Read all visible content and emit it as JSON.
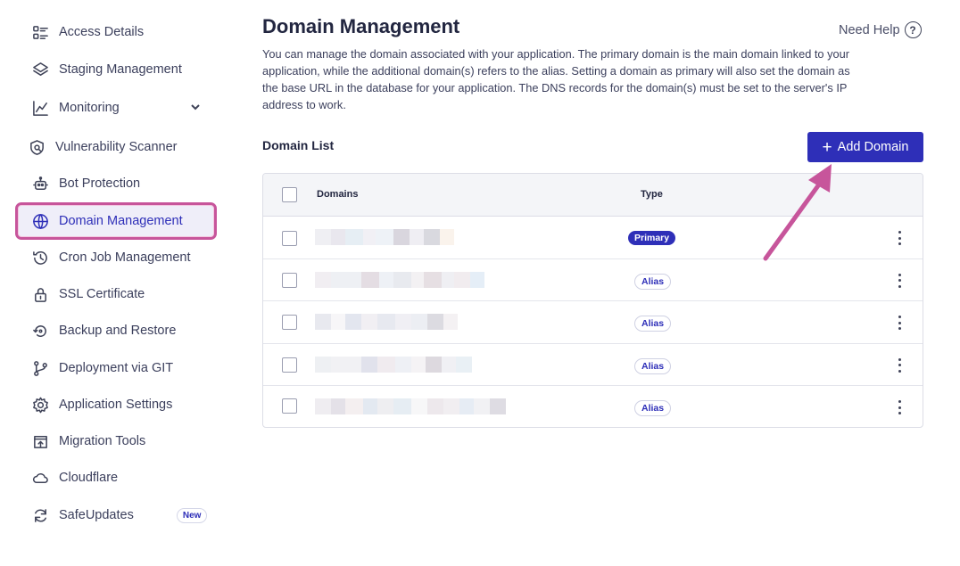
{
  "sidebar": {
    "items": [
      {
        "label": "Access Details",
        "icon": "access-details-icon"
      },
      {
        "label": "Staging Management",
        "icon": "layers-icon"
      },
      {
        "label": "Monitoring",
        "icon": "chart-line-icon"
      },
      {
        "label": "Vulnerability Scanner",
        "icon": "shield-scan-icon"
      },
      {
        "label": "Bot Protection",
        "icon": "robot-icon"
      },
      {
        "label": "Domain Management",
        "icon": "www-globe-icon"
      },
      {
        "label": "Cron Job Management",
        "icon": "clock-history-icon"
      },
      {
        "label": "SSL Certificate",
        "icon": "lock-icon"
      },
      {
        "label": "Backup and Restore",
        "icon": "backup-restore-icon"
      },
      {
        "label": "Deployment via GIT",
        "icon": "git-branch-icon"
      },
      {
        "label": "Application Settings",
        "icon": "gear-icon"
      },
      {
        "label": "Migration Tools",
        "icon": "migration-icon"
      },
      {
        "label": "Cloudflare",
        "icon": "cloud-icon"
      },
      {
        "label": "SafeUpdates",
        "icon": "refresh-icon",
        "badge": "New"
      }
    ],
    "active": "Domain Management"
  },
  "main": {
    "title": "Domain Management",
    "help": "Need Help",
    "description": "You can manage the domain associated with your application. The primary domain is the main domain linked to your application, while the additional domain(s) refers to the alias. Setting a domain as primary will also set the domain as the base URL in the database for your application. The DNS records for the domain(s) must be set to the server's IP address to work.",
    "list_heading": "Domain List",
    "add_button": "Add Domain",
    "table": {
      "columns": [
        "Domains",
        "Type"
      ],
      "rows": [
        {
          "domain": "",
          "type": "Primary"
        },
        {
          "domain": "",
          "type": "Alias"
        },
        {
          "domain": "",
          "type": "Alias"
        },
        {
          "domain": "",
          "type": "Alias"
        },
        {
          "domain": "",
          "type": "Alias"
        }
      ]
    }
  },
  "colors": {
    "accent": "#2e2fb8",
    "highlight": "#c7559b",
    "annotation_arrow": "#c7559b"
  }
}
